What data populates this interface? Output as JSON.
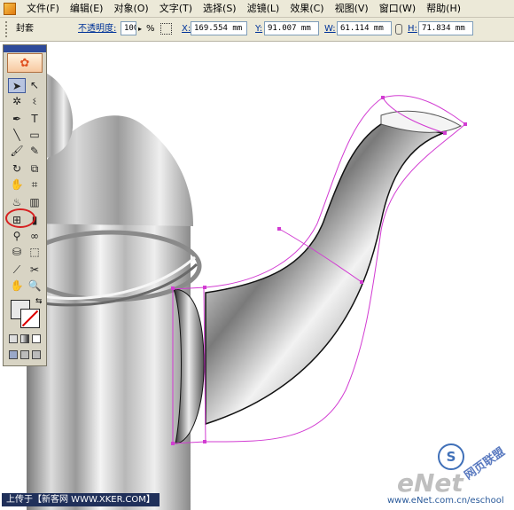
{
  "menubar": {
    "items": [
      "文件(F)",
      "编辑(E)",
      "对象(O)",
      "文字(T)",
      "选择(S)",
      "滤镜(L)",
      "效果(C)",
      "视图(V)",
      "窗口(W)",
      "帮助(H)"
    ]
  },
  "controlbar": {
    "object_type": "封套",
    "opacity_label": "不透明度:",
    "opacity_value": "100",
    "opacity_unit": "%",
    "x_label": "X:",
    "x_value": "169.554 mm",
    "y_label": "Y:",
    "y_value": "91.007 mm",
    "w_label": "W:",
    "w_value": "61.114 mm",
    "h_label": "H:",
    "h_value": "71.834 mm"
  },
  "toolbox": {
    "tools": [
      {
        "name": "selection",
        "glyph": "➤"
      },
      {
        "name": "direct-selection",
        "glyph": "↖"
      },
      {
        "name": "magic-wand",
        "glyph": "✲"
      },
      {
        "name": "lasso",
        "glyph": "ଽ"
      },
      {
        "name": "pen",
        "glyph": "✒"
      },
      {
        "name": "type",
        "glyph": "T"
      },
      {
        "name": "line",
        "glyph": "╲"
      },
      {
        "name": "rectangle",
        "glyph": "▭"
      },
      {
        "name": "paintbrush",
        "glyph": "🖌"
      },
      {
        "name": "pencil",
        "glyph": "✎"
      },
      {
        "name": "rotate",
        "glyph": "↻"
      },
      {
        "name": "scale",
        "glyph": "⧉"
      },
      {
        "name": "warp",
        "glyph": "✋"
      },
      {
        "name": "free-transform",
        "glyph": "⌗"
      },
      {
        "name": "symbol-sprayer",
        "glyph": "♨"
      },
      {
        "name": "column-graph",
        "glyph": "▥"
      },
      {
        "name": "mesh",
        "glyph": "⊞"
      },
      {
        "name": "gradient",
        "glyph": "▮"
      },
      {
        "name": "eyedropper",
        "glyph": "⚲"
      },
      {
        "name": "blend",
        "glyph": "∞"
      },
      {
        "name": "live-paint-bucket",
        "glyph": "⛁"
      },
      {
        "name": "live-paint-selection",
        "glyph": "⬚"
      },
      {
        "name": "slice",
        "glyph": "⟋"
      },
      {
        "name": "scissors",
        "glyph": "✂"
      },
      {
        "name": "hand",
        "glyph": "✋"
      },
      {
        "name": "zoom",
        "glyph": "🔍"
      }
    ]
  },
  "credit": "上传于【新客网 WWW.XKER.COM】",
  "watermark": {
    "brand": "eNet",
    "url": "www.eNet.com.cn/eschool",
    "badge": "S",
    "cn": "网页联盟"
  },
  "colors": {
    "chrome": "#ece9d8",
    "selection_path": "#d23cd2",
    "highlight_ring": "#d62020"
  }
}
